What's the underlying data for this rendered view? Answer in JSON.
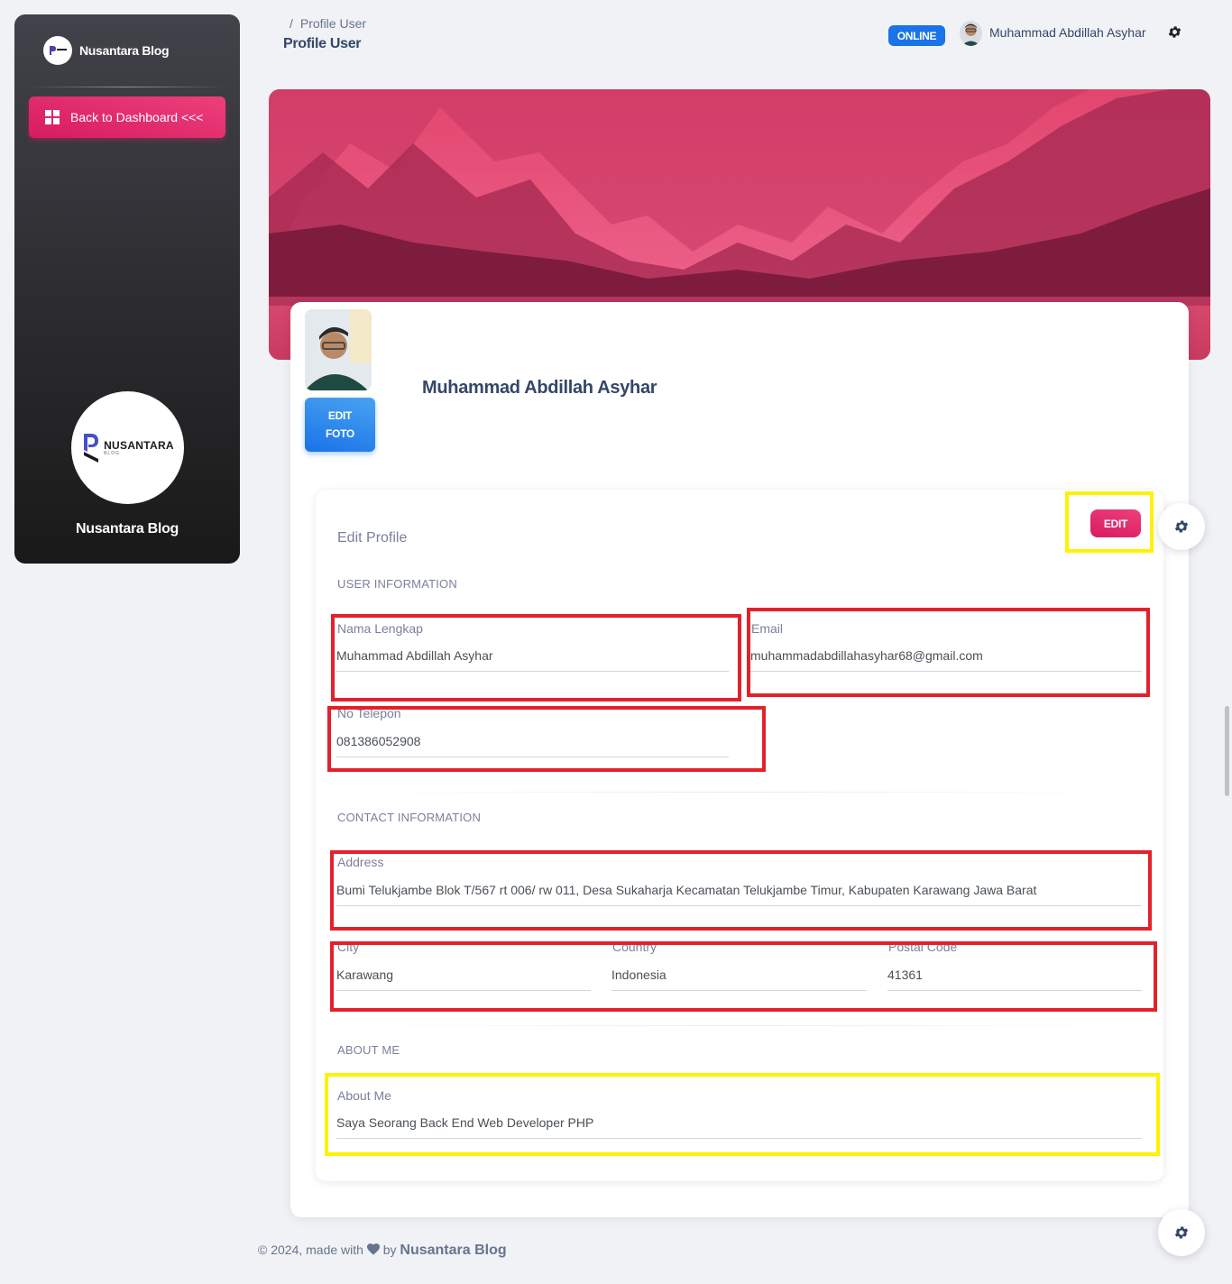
{
  "sidebar": {
    "brand": "Nusantara Blog",
    "back_label": "Back to Dashboard <<<",
    "logo_word": "NUSANTARA",
    "logo_sub": "BLOG",
    "footer_name": "Nusantara Blog"
  },
  "navbar": {
    "breadcrumb_sep": "/",
    "breadcrumb_current": "Profile User",
    "page_title": "Profile User",
    "status_badge": "ONLINE",
    "user_name": "Muhammad Abdillah Asyhar"
  },
  "profile": {
    "name": "Muhammad Abdillah Asyhar",
    "edit_photo_label": [
      "EDIT",
      "FOTO"
    ],
    "edit_title": "Edit Profile",
    "edit_button": "EDIT",
    "sections": {
      "user": "USER INFORMATION",
      "contact": "CONTACT INFORMATION",
      "about": "ABOUT ME"
    },
    "fields": {
      "nama": {
        "label": "Nama Lengkap",
        "value": "Muhammad Abdillah Asyhar"
      },
      "email": {
        "label": "Email",
        "value": "muhammadabdillahasyhar68@gmail.com"
      },
      "telepon": {
        "label": "No Telepon",
        "value": "081386052908"
      },
      "address": {
        "label": "Address",
        "value": "Bumi Telukjambe Blok T/567 rt 006/ rw 011, Desa Sukaharja Kecamatan Telukjambe Timur, Kabupaten Karawang Jawa Barat"
      },
      "city": {
        "label": "City",
        "value": "Karawang"
      },
      "country": {
        "label": "Country",
        "value": "Indonesia"
      },
      "postal": {
        "label": "Postal Code",
        "value": "41361"
      },
      "about": {
        "label": "About Me",
        "value": "Saya Seorang Back End Web Developer PHP"
      }
    }
  },
  "footer": {
    "prefix": "© 2024, made with",
    "by": "by",
    "brand": "Nusantara Blog"
  },
  "colors": {
    "primary": "#e91e63",
    "info": "#1a73e8",
    "annotation_red": "#e3212a",
    "annotation_yellow": "#fff200"
  }
}
